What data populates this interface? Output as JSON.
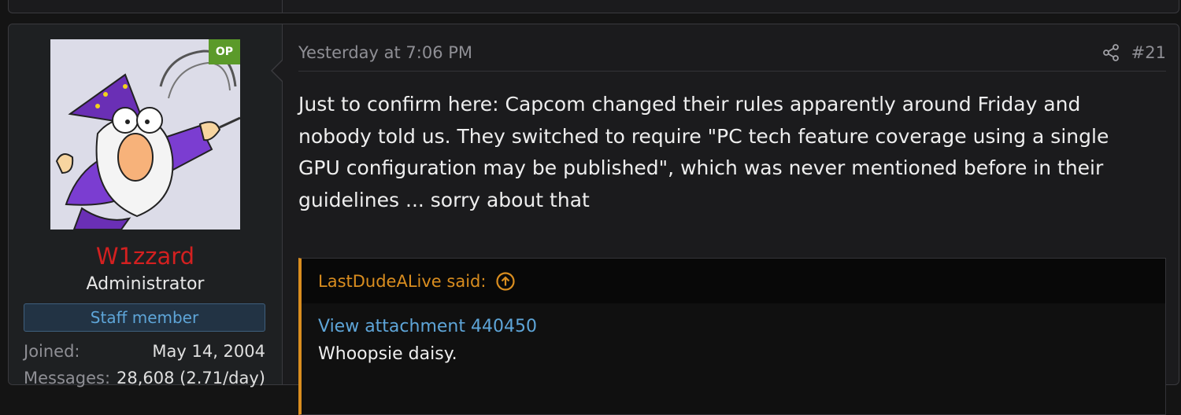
{
  "post": {
    "user": {
      "op_badge": "OP",
      "username": "W1zzard",
      "title": "Administrator",
      "banner": "Staff member",
      "avatar_icon": "wizard-avatar",
      "stats": [
        {
          "label": "Joined:",
          "value": "May 14, 2004"
        },
        {
          "label": "Messages:",
          "value": "28,608 (2.71/day)"
        }
      ]
    },
    "date": "Yesterday at 7:06 PM",
    "share_icon": "share-icon",
    "number": "#21",
    "body": "Just to confirm here: Capcom changed their rules apparently around Friday and nobody told us. They switched to require \"PC tech feature coverage using a single GPU configuration may be published\", which was never mentioned before in their guidelines ... sorry about that",
    "quote": {
      "author": "LastDudeALive said:",
      "jump_icon": "arrow-up-circle-icon",
      "attachment": "View attachment 440450",
      "text": "Whoopsie daisy."
    }
  },
  "colors": {
    "username": "#d32020",
    "link": "#5ea5d8",
    "quote_accent": "#d98d1f",
    "op_badge": "#5b9a2a"
  }
}
